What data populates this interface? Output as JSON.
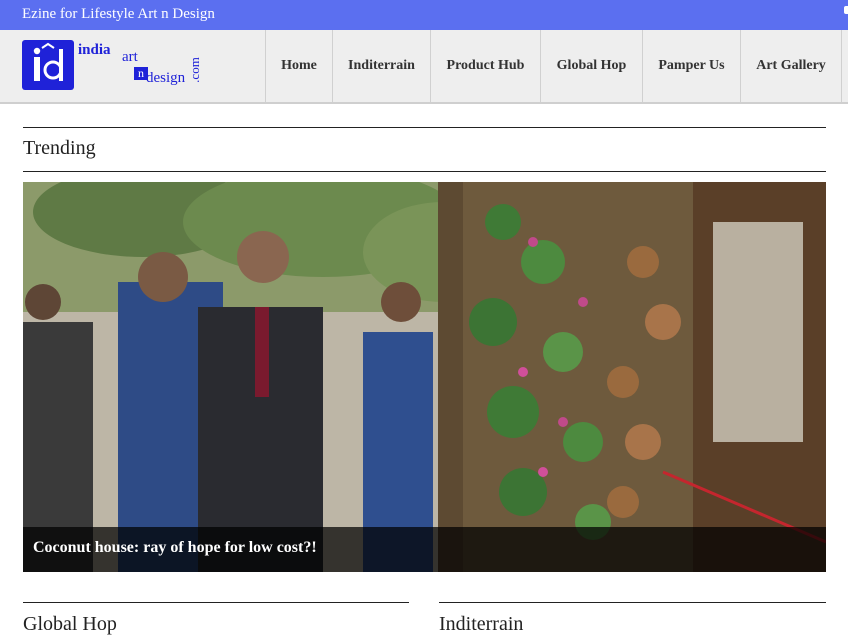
{
  "topbar": {
    "tagline": "Ezine for Lifestyle Art n Design"
  },
  "logo": {
    "india": "india",
    "art": "art",
    "n": "n",
    "design": "design",
    "com": ".com"
  },
  "nav": {
    "items": [
      {
        "label": "Home"
      },
      {
        "label": "Inditerrain"
      },
      {
        "label": "Product Hub"
      },
      {
        "label": "Global Hop"
      },
      {
        "label": "Pamper Us"
      },
      {
        "label": "Art Gallery"
      }
    ]
  },
  "trending": {
    "heading": "Trending",
    "feature_caption": "Coconut house: ray of hope for low cost?!"
  },
  "sections": {
    "left_heading": "Global Hop",
    "right_heading": "Inditerrain"
  },
  "colors": {
    "topbar": "#5b6ff0",
    "logo_blue": "#1f22d8",
    "header_bg": "#eeeeee"
  }
}
